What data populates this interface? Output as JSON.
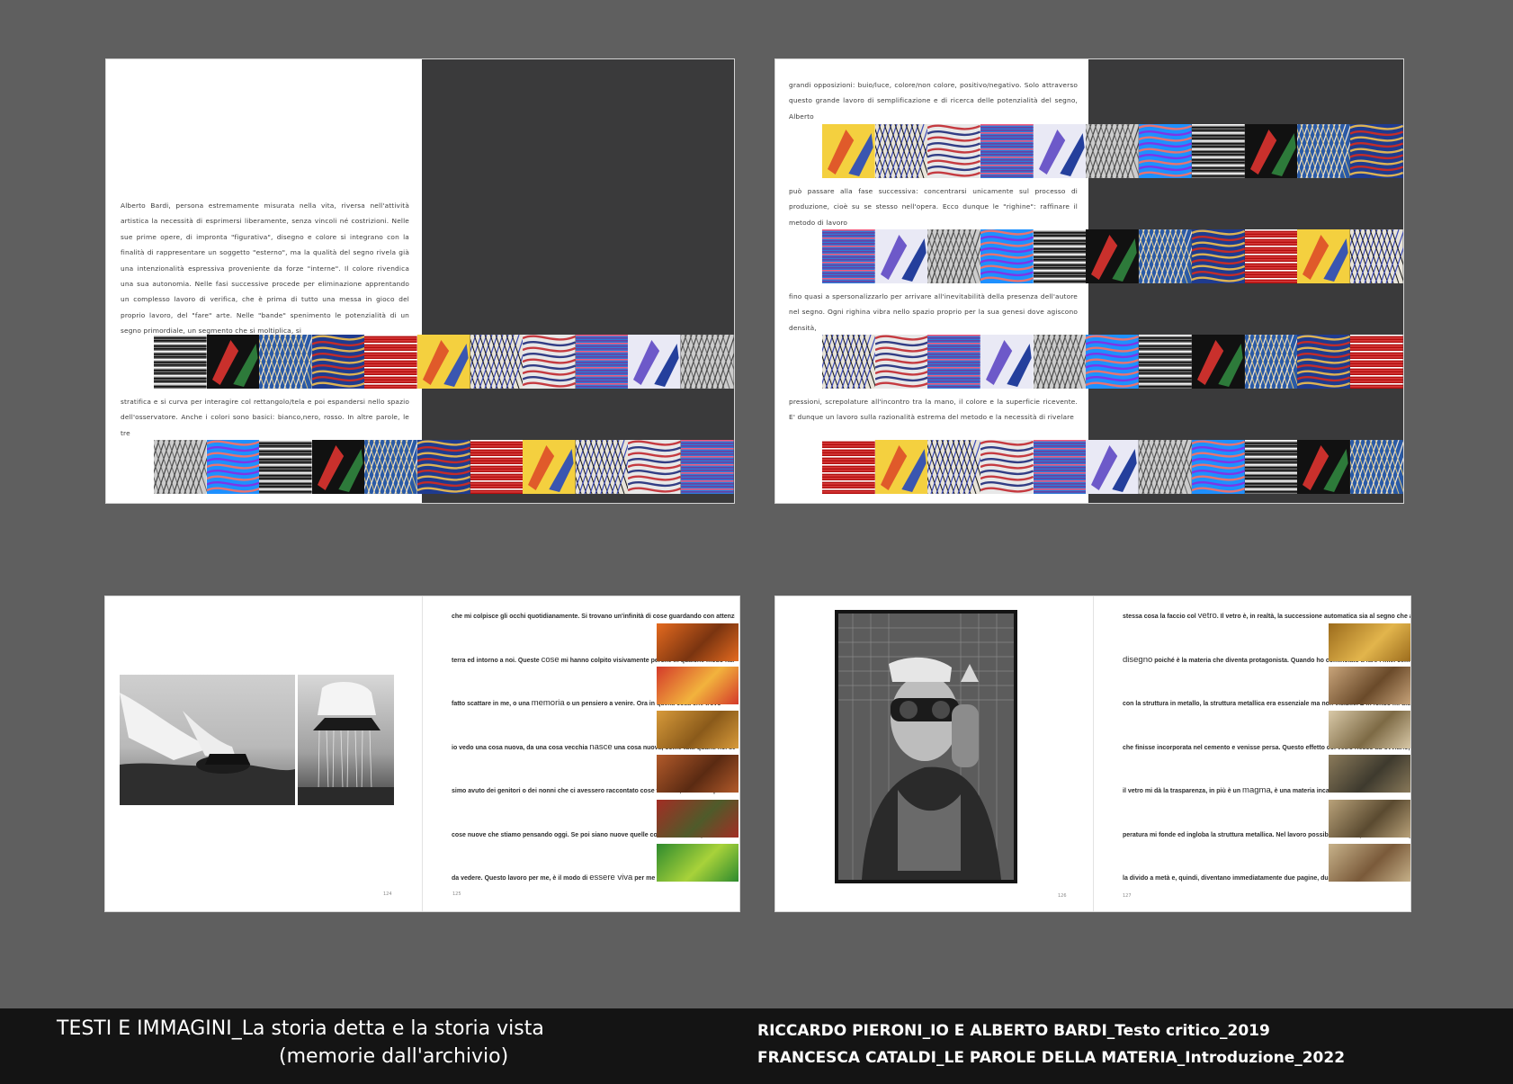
{
  "spread1": {
    "paragraph1": "Alberto Bardi, persona estremamente misurata nella vita, riversa nell'attività artistica la necessità di esprimersi liberamente, senza vincoli né costrizioni. Nelle sue prime opere, di impronta \"figurativa\", disegno e colore si integrano con la finalità di rappresentare un soggetto \"esterno\", ma la qualità del segno rivela già una intenzionalità espressiva proveniente da forze \"interne\". Il colore rivendica una sua autonomia. Nelle fasi successive procede per eliminazione apprentando un complesso lavoro di verifica, che è prima di tutto una messa in gioco del proprio lavoro, del \"fare\" arte. Nelle \"bande\" spenimento le potenzialità di un segno primordiale, un segmento che si moltiplica, si",
    "paragraph2": "stratifica e si curva per interagire col rettangolo/tela e poi espandersi nello spazio dell'osservatore. Anche i colori sono basici: bianco,nero, rosso. In altre parole, le tre"
  },
  "spread2": {
    "paragraph1": "grandi opposizioni: buio/luce, colore/non colore, positivo/negativo. Solo attraverso questo grande lavoro di semplificazione e di ricerca delle potenzialità del segno, Alberto",
    "paragraph2": "può passare alla fase successiva: concentrarsi unicamente sul processo di produzione, cioè su se stesso nell'opera. Ecco dunque le \"righine\": raffinare il metodo di lavoro",
    "paragraph3": "fino quasi a spersonalizzarlo per arrivare all'inevitabilità della presenza dell'autore nel segno. Ogni righina vibra nello spazio proprio per la sua genesi dove agiscono densità,",
    "paragraph4": "pressioni, screpolature all'incontro tra la mano, il colore e la superficie ricevente. E' dunque un lavoro sulla razionalità estrema del metodo e la necessità di rivelare"
  },
  "spread3": {
    "lines": [
      [
        "che mi colpisce gli occhi quotidianamente. Si trovano un'infinità di cose guardando con attenzione per",
        "",
        ""
      ],
      [
        "terra ed intorno a noi. Queste ",
        "cose",
        " mi hanno colpito visivamente perché in qualche modo hanno"
      ],
      [
        "fatto scattare in me, o una ",
        "memoria",
        " o un pensiero a venire. Ora in quella cosa che trovo"
      ],
      [
        "io vedo una cosa nuova, da una cosa vecchia ",
        "nasce",
        " una cosa nuova, come tutti quanti noi se non aves-"
      ],
      [
        "simo avuto dei genitori o dei nonni che ci avessero raccontato cose vecchie, forse non penseremmo le",
        "",
        ""
      ],
      [
        "cose nuove che stiamo pensando oggi. Se poi siano nuove quelle cose che stiamo pensando è ancora",
        "",
        ""
      ],
      [
        "da vedere. Questo lavoro per me, è il modo di ",
        "essere viva",
        " per me stessa, per quello che mi scatta"
      ]
    ],
    "page_left": "124",
    "page_right": "125"
  },
  "spread4": {
    "lines": [
      [
        "stessa cosa la faccio col ",
        "vetro",
        ". Il vetro è, in realtà, la successione automatica sia al segno che al"
      ],
      [
        "",
        "disegno",
        " poiché è la materia che diventa protagonista. Quando ho cominciato a fare i miei cementi"
      ],
      [
        "con la struttura in metallo, la struttura metallica era essenziale ma non visibile. E in fondo mi dispiaceva",
        "",
        ""
      ],
      [
        "che finisse incorporata nel cemento e venisse persa. Questo effetto col vetro riesco ad ovviarlo, perché",
        "",
        ""
      ],
      [
        "il vetro mi dà la trasparenza, in più è un ",
        "magma",
        ", è una materia incandescente che a una certa tem-"
      ],
      [
        "peratura mi fonde ed ingloba la struttura metallica. Nel lavoro possibilmente io prendo un'immagine,",
        "",
        ""
      ],
      [
        "la divido a metà e, quindi, diventano immediatamente due pagine, due facciate. Perché c'è sempre in un",
        "",
        ""
      ]
    ],
    "page_left": "126",
    "page_right": "127"
  },
  "caption": {
    "left_line1": "TESTI E IMMAGINI_La storia detta e la storia vista",
    "left_line2": "(memorie dall'archivio)",
    "right_line1": "RICCARDO PIERONI_IO E ALBERTO BARDI_Testo critico_2019",
    "right_line2": "FRANCESCA CATALDI_LE PAROLE DELLA MATERIA_Introduzione_2022"
  },
  "colors": {
    "background": "#5f5f5f",
    "page": "#ffffff",
    "dark_panel": "#3a3a3b",
    "caption_bar": "#141414"
  }
}
